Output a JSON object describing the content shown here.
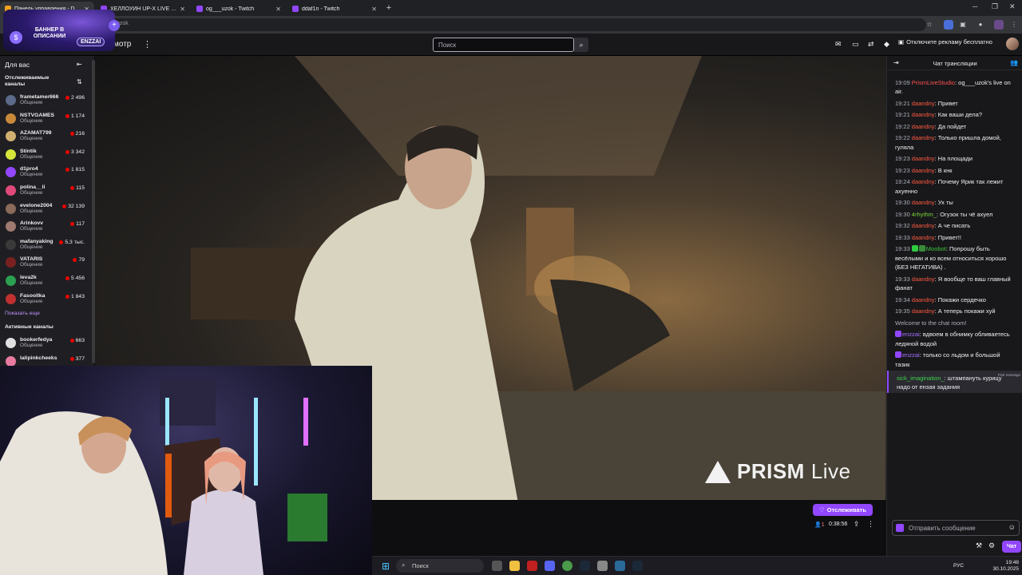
{
  "browser": {
    "tabs": [
      {
        "title": "Панель управления - Donatio",
        "active": true
      },
      {
        "title": "ХЕЛЛОУИН UP-X LIVE - Twitch",
        "active": false
      },
      {
        "title": "og___uzok - Twitch",
        "active": false
      },
      {
        "title": "ddaf1n - Twitch",
        "active": false
      }
    ],
    "url_fragment": "uzok"
  },
  "banner": {
    "text": "БАННЕР В ОПИСАНИИ",
    "tag": "ENZZAI"
  },
  "topnav": {
    "browse_label": "мотр",
    "search_placeholder": "Поиск",
    "adfree_label": "Отключите рекламу бесплатно"
  },
  "sidebar": {
    "title": "Для вас",
    "followed_title": "Отслеживаемые каналы",
    "followed": [
      {
        "name": "frametamer666",
        "category": "Общение",
        "viewers": "2 496",
        "color": "#5c6a8a"
      },
      {
        "name": "NSTVGAMES",
        "category": "Общение",
        "viewers": "1 174",
        "color": "#c88a3a"
      },
      {
        "name": "AZAMAT799",
        "category": "Общение",
        "viewers": "216",
        "color": "#d0b070"
      },
      {
        "name": "Stintik",
        "category": "Общение",
        "viewers": "3 342",
        "color": "#d6e63a"
      },
      {
        "name": "d1pro4",
        "category": "Общение",
        "viewers": "1 815",
        "color": "#9147ff"
      },
      {
        "name": "polina__li",
        "category": "Общение",
        "viewers": "115",
        "color": "#e04a7a"
      },
      {
        "name": "evelone2004",
        "category": "Общение",
        "viewers": "32 139",
        "color": "#8a6a5a"
      },
      {
        "name": "Arinkovv",
        "category": "Общение",
        "viewers": "117",
        "color": "#a07a70"
      },
      {
        "name": "mafanyaking",
        "category": "Общение",
        "viewers": "5,3 тыс.",
        "color": "#3a3a3a"
      },
      {
        "name": "VATARIS",
        "category": "Общение",
        "viewers": "79",
        "color": "#7a2020"
      },
      {
        "name": "leva2k",
        "category": "Общение",
        "viewers": "5 456",
        "color": "#2aa050"
      },
      {
        "name": "Fasoollka",
        "category": "Общение",
        "viewers": "1 843",
        "color": "#c03030"
      }
    ],
    "show_more": "Показать еще",
    "active_title": "Активные каналы",
    "active": [
      {
        "name": "bookerfedya",
        "category": "Общение",
        "viewers": "663",
        "color": "#e0e0e0"
      },
      {
        "name": "lalipinkcheeks",
        "category": "",
        "viewers": "377",
        "color": "#e87aa0"
      }
    ]
  },
  "video": {
    "watermark": "PRISM",
    "watermark_suffix": "Live"
  },
  "stream_info": {
    "follow_label": "Отслеживать",
    "viewers": "1",
    "uptime": "0:38:56"
  },
  "chat": {
    "header": "Чат трансляции",
    "messages": [
      {
        "time": "19:09",
        "user": "PrismLiveStudio",
        "color": "#ff4f4f",
        "text": "og___uzok's live on air."
      },
      {
        "time": "19:21",
        "user": "daandny",
        "color": "#ff5a3d",
        "text": "Привет"
      },
      {
        "time": "19:21",
        "user": "daandny",
        "color": "#ff5a3d",
        "text": "Как ваши дела?"
      },
      {
        "time": "19:22",
        "user": "daandny",
        "color": "#ff5a3d",
        "text": "Да пойдет"
      },
      {
        "time": "19:22",
        "user": "daandny",
        "color": "#ff5a3d",
        "text": "Только пришла домой, гуляла"
      },
      {
        "time": "19:23",
        "user": "daandny",
        "color": "#ff5a3d",
        "text": "На площади"
      },
      {
        "time": "19:23",
        "user": "daandny",
        "color": "#ff5a3d",
        "text": "В кнк"
      },
      {
        "time": "19:24",
        "user": "daandny",
        "color": "#ff5a3d",
        "text": "Почему Ярик так лежит ахуенно"
      },
      {
        "time": "19:30",
        "user": "daandny",
        "color": "#ff5a3d",
        "text": "Ух ты"
      },
      {
        "time": "19:30",
        "user": "4rhythm_",
        "color": "#7ad33a",
        "text": "Огузок ты чё ахуел"
      },
      {
        "time": "19:32",
        "user": "daandny",
        "color": "#ff5a3d",
        "text": "А че писать"
      },
      {
        "time": "19:33",
        "user": "daandny",
        "color": "#ff5a3d",
        "text": "Привет!!"
      },
      {
        "time": "19:33",
        "user": "Moobot",
        "color": "#3fc33a",
        "text": "Попрошу быть весёлыми и ко всем относиться хорошо (БЕЗ НЕГАТИВА) .",
        "badges": [
          "#2ecc40",
          "#3a8a3a"
        ]
      },
      {
        "time": "19:33",
        "user": "daandny",
        "color": "#ff5a3d",
        "text": "Я вообще то ваш главный фанат"
      },
      {
        "time": "19:34",
        "user": "daandny",
        "color": "#ff5a3d",
        "text": "Покажи сердечко"
      },
      {
        "time": "19:35",
        "user": "daandny",
        "color": "#ff5a3d",
        "text": "А теперь покажи хуй"
      }
    ],
    "system_message": "Welcome to the chat room!",
    "late_messages": [
      {
        "user": "enzzai",
        "color": "#a970ff",
        "text": "вдвоем в обнимку обливаетесь ледяной водой",
        "badges": [
          "#9147ff"
        ]
      },
      {
        "user": "enzzai",
        "color": "#a970ff",
        "text": "только со льдом и большой тазик",
        "badges": [
          "#9147ff"
        ]
      }
    ],
    "highlight": {
      "first_label": "First message",
      "user": "sick_imagination_",
      "color": "#3fd34a",
      "text": "штампануть курицу надо от ензая задания"
    },
    "input_placeholder": "Отправить сообщение",
    "chat_button": "Чат"
  },
  "taskbar": {
    "search_placeholder": "Поиск",
    "lang": "РУС",
    "time": "19:48",
    "date": "30.10.2025"
  }
}
